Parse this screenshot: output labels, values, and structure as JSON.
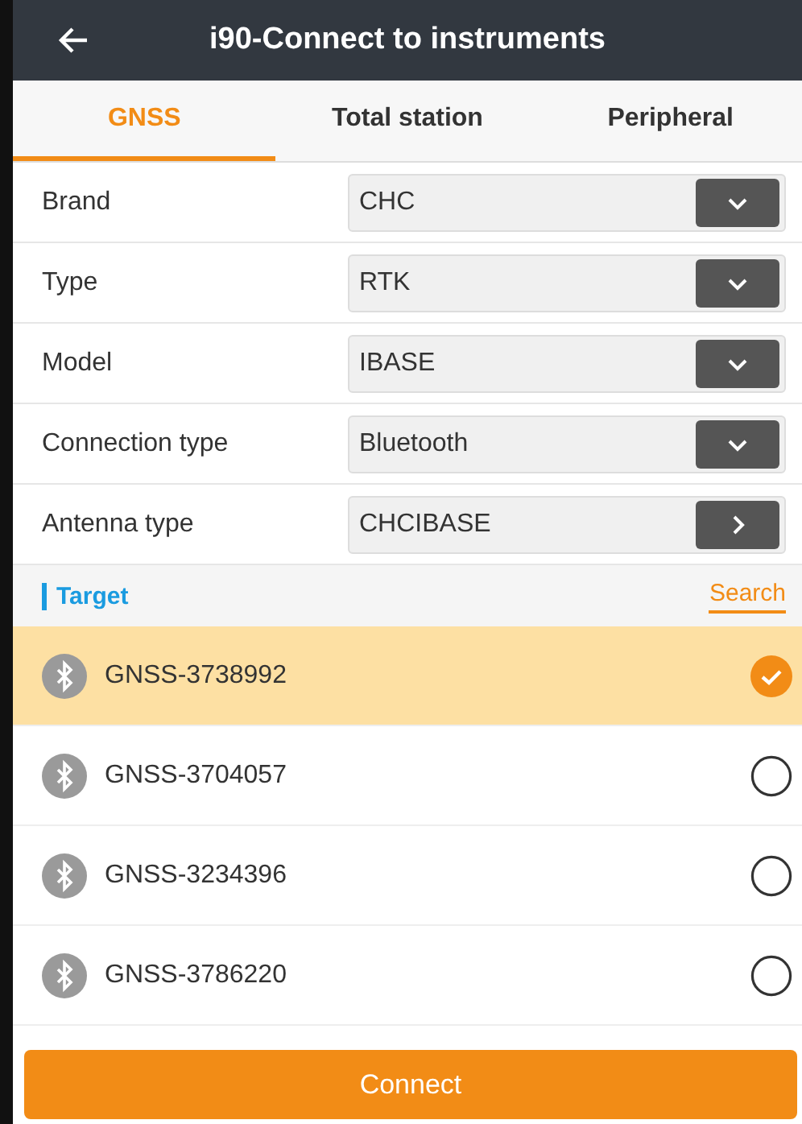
{
  "header": {
    "title": "i90-Connect to instruments"
  },
  "tabs": [
    {
      "label": "GNSS",
      "selected": true
    },
    {
      "label": "Total station",
      "selected": false
    },
    {
      "label": "Peripheral",
      "selected": false
    }
  ],
  "form": [
    {
      "label": "Brand",
      "value": "CHC",
      "kind": "dropdown"
    },
    {
      "label": "Type",
      "value": "RTK",
      "kind": "dropdown"
    },
    {
      "label": "Model",
      "value": "IBASE",
      "kind": "dropdown"
    },
    {
      "label": "Connection type",
      "value": "Bluetooth",
      "kind": "dropdown"
    },
    {
      "label": "Antenna type",
      "value": "CHCIBASE",
      "kind": "link"
    }
  ],
  "section": {
    "title": "Target",
    "action": "Search"
  },
  "devices": [
    {
      "name": "GNSS-3738992",
      "selected": true
    },
    {
      "name": "GNSS-3704057",
      "selected": false
    },
    {
      "name": "GNSS-3234396",
      "selected": false
    },
    {
      "name": "GNSS-3786220",
      "selected": false
    }
  ],
  "button": "Connect"
}
